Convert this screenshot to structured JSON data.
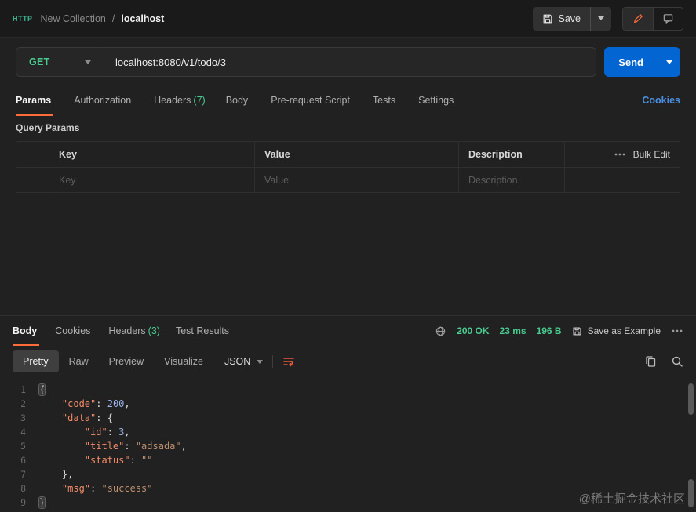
{
  "colors": {
    "accent": "#ff6c37",
    "success_green": "#49cc90",
    "send_blue": "#0265d2",
    "link_blue": "#4a90e2"
  },
  "header": {
    "request_icon_label": "HTTP",
    "breadcrumb": {
      "collection": "New Collection",
      "separator": "/",
      "request": "localhost"
    },
    "save_label": "Save"
  },
  "request": {
    "method": "GET",
    "url": "localhost:8080/v1/todo/3",
    "send_label": "Send"
  },
  "request_tabs": {
    "items": [
      {
        "label": "Params",
        "count": ""
      },
      {
        "label": "Authorization",
        "count": ""
      },
      {
        "label": "Headers",
        "count": "(7)"
      },
      {
        "label": "Body",
        "count": ""
      },
      {
        "label": "Pre-request Script",
        "count": ""
      },
      {
        "label": "Tests",
        "count": ""
      },
      {
        "label": "Settings",
        "count": ""
      }
    ],
    "cookies_link": "Cookies"
  },
  "params": {
    "section_title": "Query Params",
    "columns": [
      "Key",
      "Value",
      "Description"
    ],
    "bulk_edit_label": "Bulk Edit",
    "placeholders": {
      "key": "Key",
      "value": "Value",
      "description": "Description"
    }
  },
  "response": {
    "tabs": [
      {
        "label": "Body",
        "count": ""
      },
      {
        "label": "Cookies",
        "count": ""
      },
      {
        "label": "Headers",
        "count": "(3)"
      },
      {
        "label": "Test Results",
        "count": ""
      }
    ],
    "status": "200 OK",
    "time": "23 ms",
    "size": "196 B",
    "save_as_example_label": "Save as Example",
    "view_modes": [
      "Pretty",
      "Raw",
      "Preview",
      "Visualize"
    ],
    "format": "JSON",
    "code": {
      "lines": [
        {
          "num": 1,
          "tokens": [
            {
              "c": "b",
              "t": "{"
            }
          ]
        },
        {
          "num": 2,
          "tokens": [
            {
              "c": "p",
              "t": "    "
            },
            {
              "c": "k",
              "t": "\"code\""
            },
            {
              "c": "p",
              "t": ": "
            },
            {
              "c": "n",
              "t": "200"
            },
            {
              "c": "p",
              "t": ","
            }
          ]
        },
        {
          "num": 3,
          "tokens": [
            {
              "c": "p",
              "t": "    "
            },
            {
              "c": "k",
              "t": "\"data\""
            },
            {
              "c": "p",
              "t": ": {"
            }
          ]
        },
        {
          "num": 4,
          "tokens": [
            {
              "c": "p",
              "t": "        "
            },
            {
              "c": "k",
              "t": "\"id\""
            },
            {
              "c": "p",
              "t": ": "
            },
            {
              "c": "n",
              "t": "3"
            },
            {
              "c": "p",
              "t": ","
            }
          ]
        },
        {
          "num": 5,
          "tokens": [
            {
              "c": "p",
              "t": "        "
            },
            {
              "c": "k",
              "t": "\"title\""
            },
            {
              "c": "p",
              "t": ": "
            },
            {
              "c": "s",
              "t": "\"adsada\""
            },
            {
              "c": "p",
              "t": ","
            }
          ]
        },
        {
          "num": 6,
          "tokens": [
            {
              "c": "p",
              "t": "        "
            },
            {
              "c": "k",
              "t": "\"status\""
            },
            {
              "c": "p",
              "t": ": "
            },
            {
              "c": "s",
              "t": "\"\""
            }
          ]
        },
        {
          "num": 7,
          "tokens": [
            {
              "c": "p",
              "t": "    "
            },
            {
              "c": "p",
              "t": "},"
            }
          ]
        },
        {
          "num": 8,
          "tokens": [
            {
              "c": "p",
              "t": "    "
            },
            {
              "c": "k",
              "t": "\"msg\""
            },
            {
              "c": "p",
              "t": ": "
            },
            {
              "c": "s",
              "t": "\"success\""
            }
          ]
        },
        {
          "num": 9,
          "tokens": [
            {
              "c": "b",
              "t": "}"
            }
          ]
        }
      ]
    }
  },
  "watermark": "@稀土掘金技术社区"
}
